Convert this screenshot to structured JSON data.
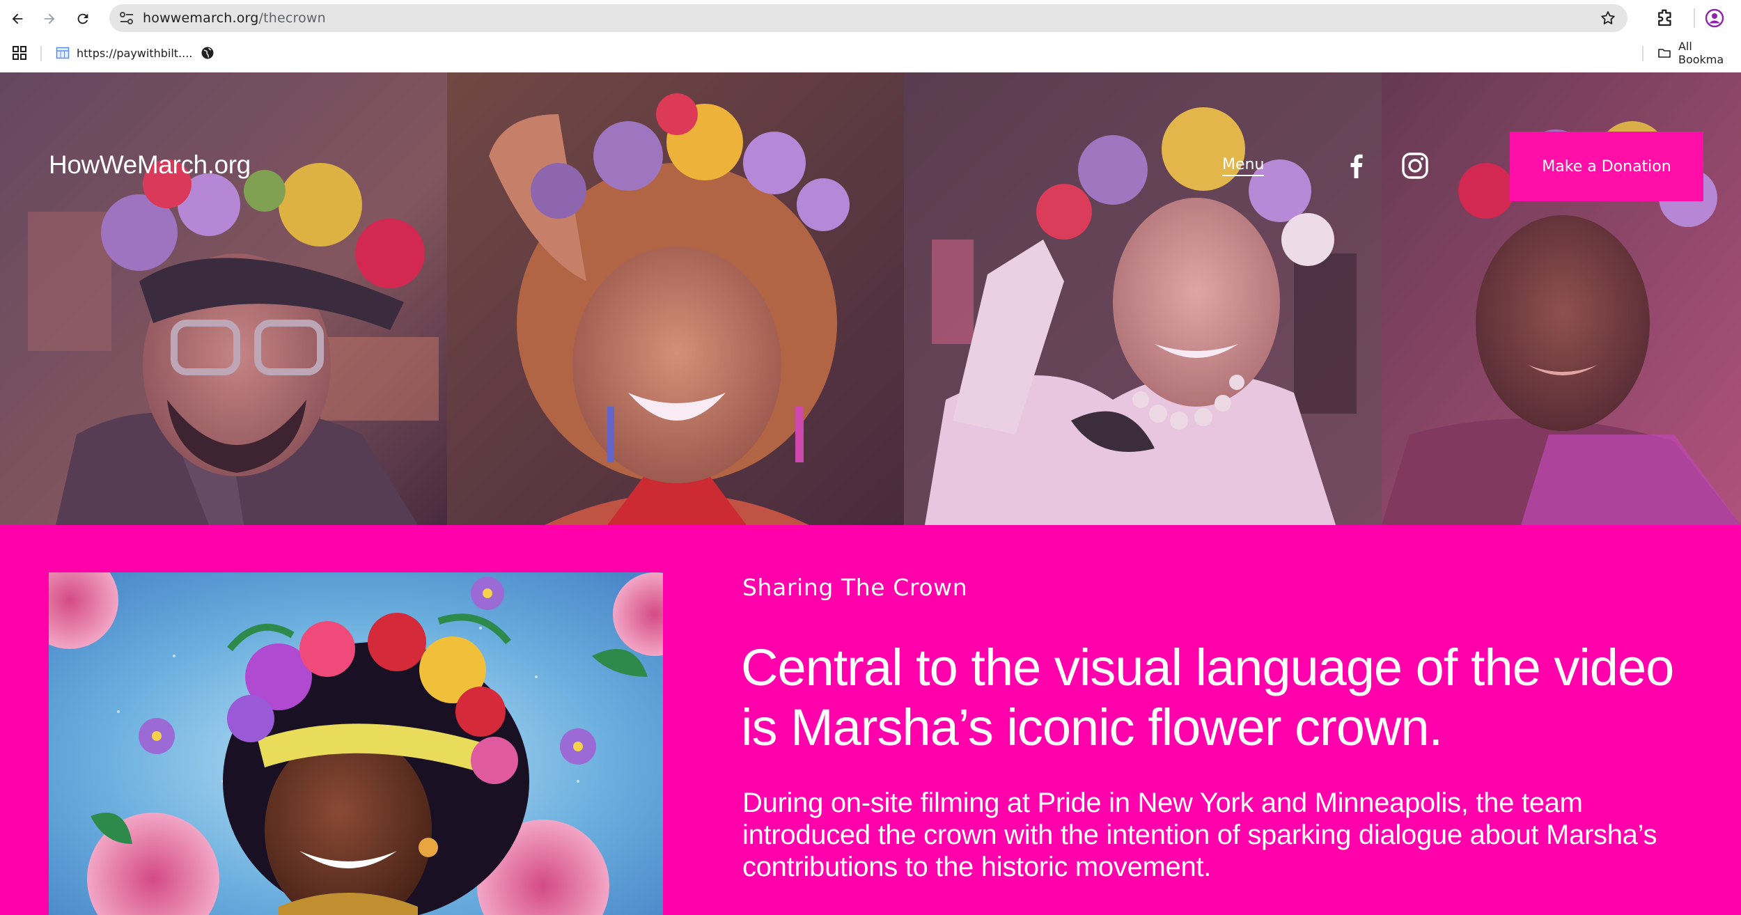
{
  "browser": {
    "url_domain": "howwemarch.org",
    "url_path": "/thecrown",
    "bookmarks": [
      {
        "label": "https://paywithbilt...."
      },
      {
        "label": ""
      }
    ],
    "all_bookmarks_label": "All Bookma"
  },
  "header": {
    "brand": "HowWeMarch.org",
    "menu_label": "Menu",
    "donate_label": "Make a Donation"
  },
  "hero": {
    "photos": [
      {
        "subject": "man in cap and glasses wearing flower crown"
      },
      {
        "subject": "smiling woman with curly hair wearing flower crown"
      },
      {
        "subject": "older man in white shirt with pearls wearing flower crown"
      },
      {
        "subject": "woman with flower crown and nose ring"
      }
    ]
  },
  "content": {
    "eyebrow": "Sharing The Crown",
    "headline": "Central to the visual language of the video is Marsha’s iconic flower crown.",
    "body": "During on-site filming at Pride in New York and Minneapolis, the team introduced the crown with the intention of sparking dialogue about Marsha’s contributions to the historic movement."
  },
  "colors": {
    "brand_pink": "#ff00aa",
    "button_pink": "#ff0fa8",
    "text": "#ffffff"
  }
}
